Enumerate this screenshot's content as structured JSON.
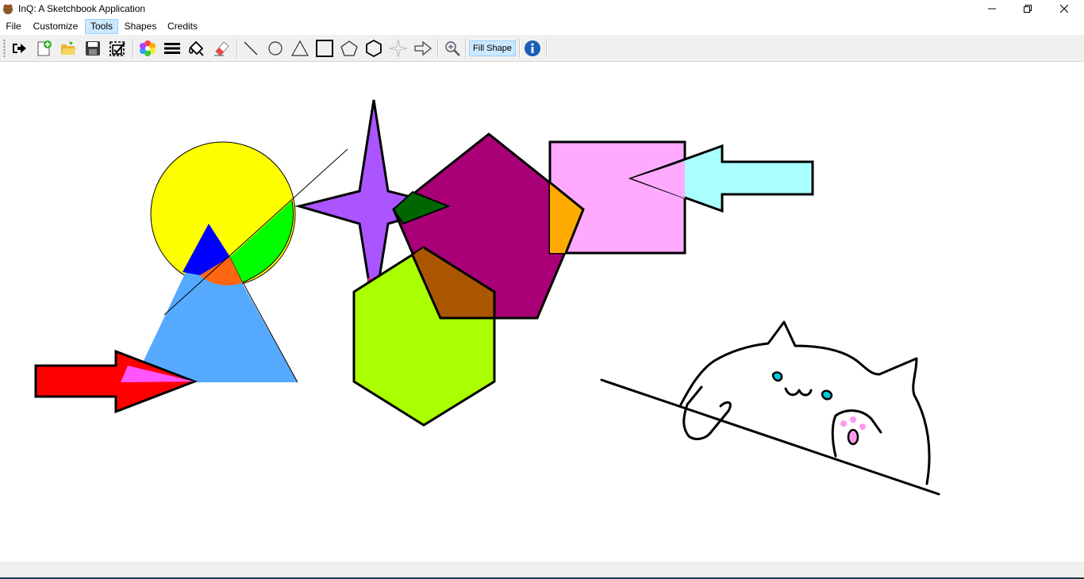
{
  "window": {
    "title": "InQ: A Sketchbook Application",
    "controls": {
      "minimize_icon": "minimize-icon",
      "maximize_icon": "restore-icon",
      "close_icon": "close-icon"
    }
  },
  "menu": {
    "items": [
      {
        "id": "file",
        "label": "File"
      },
      {
        "id": "customize",
        "label": "Customize"
      },
      {
        "id": "tools",
        "label": "Tools",
        "active": true
      },
      {
        "id": "shapes",
        "label": "Shapes"
      },
      {
        "id": "credits",
        "label": "Credits"
      }
    ]
  },
  "toolbar": {
    "tools": [
      "exit-icon",
      "new-file-icon",
      "open-folder-icon",
      "save-icon",
      "save-as-icon",
      "color-palette-icon",
      "line-thickness-icon",
      "fill-bucket-icon",
      "eraser-icon",
      "line-tool-icon",
      "circle-tool-icon",
      "triangle-tool-icon",
      "rectangle-tool-icon",
      "pentagon-tool-icon",
      "hexagon-tool-icon",
      "star-tool-icon",
      "arrow-tool-icon",
      "zoom-icon",
      "info-icon"
    ],
    "fill_shape_label": "Fill Shape",
    "fill_shape_active": true
  },
  "canvas": {
    "background": "#ffffff",
    "shapes": [
      {
        "type": "circle",
        "fill": "#ffff00",
        "stroke": "#000000"
      },
      {
        "type": "triangle",
        "fill": "#55aaff",
        "overlap_fills": [
          "#0000ff",
          "#ff6611"
        ]
      },
      {
        "type": "line",
        "stroke": "#000000"
      },
      {
        "type": "arrow",
        "fill": "#ff0000",
        "overlap_fill": "#ff55ff"
      },
      {
        "type": "star",
        "fill": "#aa55ff",
        "overlap_fill": "#ff2277"
      },
      {
        "type": "pentagon",
        "fill": "#aa0077",
        "overlap_fills": [
          "#006600",
          "#aa5500",
          "#ffaa00"
        ]
      },
      {
        "type": "hexagon",
        "fill": "#aaff00"
      },
      {
        "type": "rectangle",
        "fill": "#ffaaff"
      },
      {
        "type": "arrow",
        "fill": "#aaffff"
      },
      {
        "type": "freehand",
        "subject": "cat",
        "stroke": "#000000",
        "accents": [
          "#00ccdd",
          "#ff99ee"
        ]
      }
    ]
  }
}
